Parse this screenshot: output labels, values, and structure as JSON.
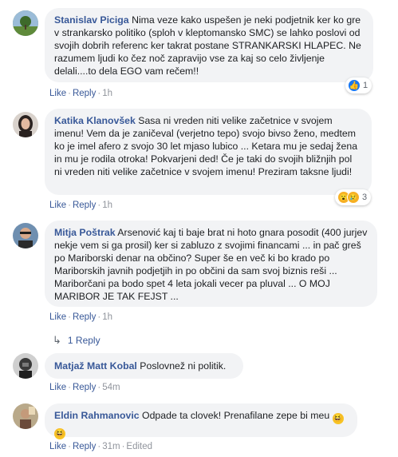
{
  "comments": [
    {
      "author": "Stanislav Piciga",
      "text": "Nima veze kako uspešen je neki podjetnik ker ko gre v strankarsko politiko (sploh v kleptomansko SMC) se lahko poslovi od svojih dobrih referenc ker takrat postane STRANKARSKI HLAPEC. Ne razumem ljudi ko čez noč zapravijo vse za kaj so celo življenje delali....to dela EGO vam rečem!!",
      "like": "Like",
      "reply": "Reply",
      "time": "1h",
      "reactions": "1"
    },
    {
      "author": "Katika Klanovšek",
      "text": "Sasa ni vreden niti velike začetnice v svojem imenu! Vem da je zaničeval (verjetno tepo) svojo bivso ženo, medtem ko je imel afero z svojo 30 let mjaso lubico ... Ketara mu je sedaj žena in mu je rodila otroka! Pokvarjeni ded! Če je taki do svojih bližnjih pol ni vreden niti velike začetnice v svojem imenu! Preziram taksne ljudi!",
      "like": "Like",
      "reply": "Reply",
      "time": "1h",
      "reactions": "3"
    },
    {
      "author": "Mitja Poštrak",
      "text": "Arsenović kaj ti baje brat ni hoto gnara posodit (400 jurjev nekje vem si ga prosil) ker si zabluzo z svojimi financami ... in pač greš po Mariborski denar na občino? Super še en več ki bo krado po Mariborskih javnih podjetjih in po občini da sam svoj biznis reši ... Mariborčani pa bodo spet 4 leta jokali vecer pa pluval ... O MOJ MARIBOR JE TAK FEJST ...",
      "like": "Like",
      "reply": "Reply",
      "time": "1h",
      "replies_label": "1 Reply"
    },
    {
      "author": "Matjaž Matt Kobal",
      "text": "Poslovnež ni politik.",
      "like": "Like",
      "reply": "Reply",
      "time": "54m"
    },
    {
      "author": "Eldin Rahmanovic",
      "text": "Odpade ta clovek! Prenafilane zepe bi meu",
      "like": "Like",
      "reply": "Reply",
      "time": "31m",
      "edited": "Edited"
    }
  ],
  "separator": "·",
  "icons": {
    "like_reaction": "thumbs-up-icon",
    "wow_reaction": "wow-face-icon",
    "sad_reaction": "sad-face-icon",
    "reply_arrow": "reply-arrow-icon",
    "laugh_emoji": "laughing-emoji-icon"
  },
  "colors": {
    "link": "#385898",
    "bubble": "#f2f3f5",
    "meta": "#90949c",
    "like_blue": "#1877f2"
  }
}
